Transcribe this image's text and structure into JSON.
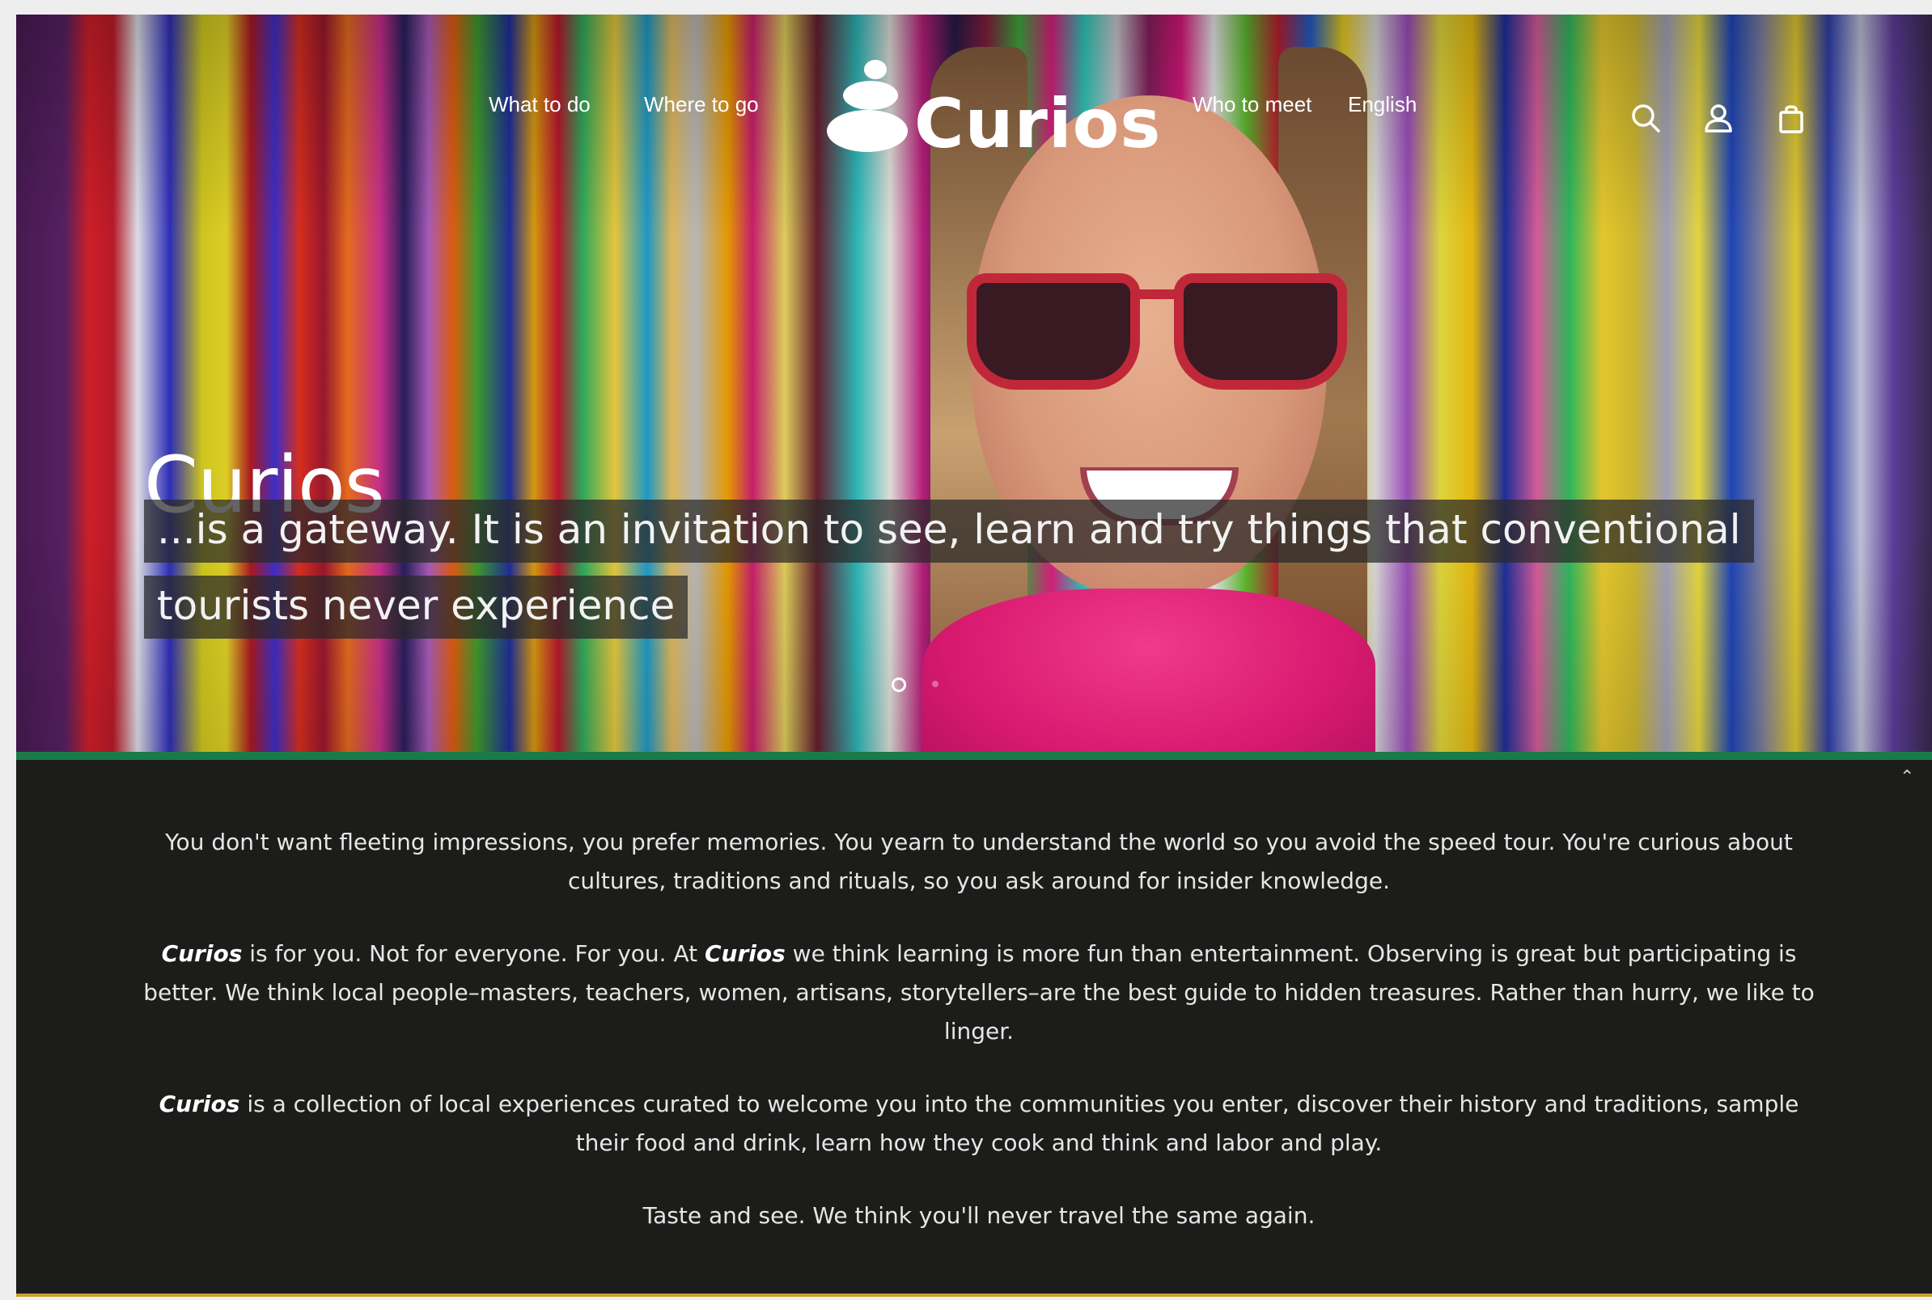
{
  "nav": {
    "left_links": [
      "What to do",
      "Where to go"
    ],
    "right_links": [
      "Who to meet",
      "English"
    ],
    "logo_text": "Curios",
    "icons": [
      "search-icon",
      "account-icon",
      "shopping-bag-icon"
    ]
  },
  "hero": {
    "title": "Curios",
    "tagline_line1": "...is a gateway. It is an invitation to see, learn and try things that conventional",
    "tagline_line2": "tourists never experience",
    "slide_count": 2,
    "active_slide": 1
  },
  "content": {
    "p1": "You don't want fleeting impressions, you prefer memories. You yearn to understand the world so you avoid the speed tour. You're curious about cultures, traditions and rituals, so you ask around for insider knowledge.",
    "p2_brand_a": "Curios",
    "p2_text_a": " is for you. Not for everyone. For you. At ",
    "p2_brand_b": "Curios",
    "p2_text_b": " we think learning is more fun than entertainment. Observing is great but participating is better. We think local people–masters, teachers, women, artisans, storytellers–are the best guide to hidden treasures. Rather than hurry, we like to linger.",
    "p3_brand": "Curios",
    "p3_text": " is a collection of local experiences curated to welcome you into the communities you enter, discover their history and traditions, sample their food and drink, learn how they cook and think and labor and play.",
    "p4": "Taste and see. We think you'll never travel the same again."
  },
  "colors": {
    "dark_bg": "#1c1c1a",
    "accent_green": "#1b7a4a",
    "text_light": "#e6e6e6"
  }
}
